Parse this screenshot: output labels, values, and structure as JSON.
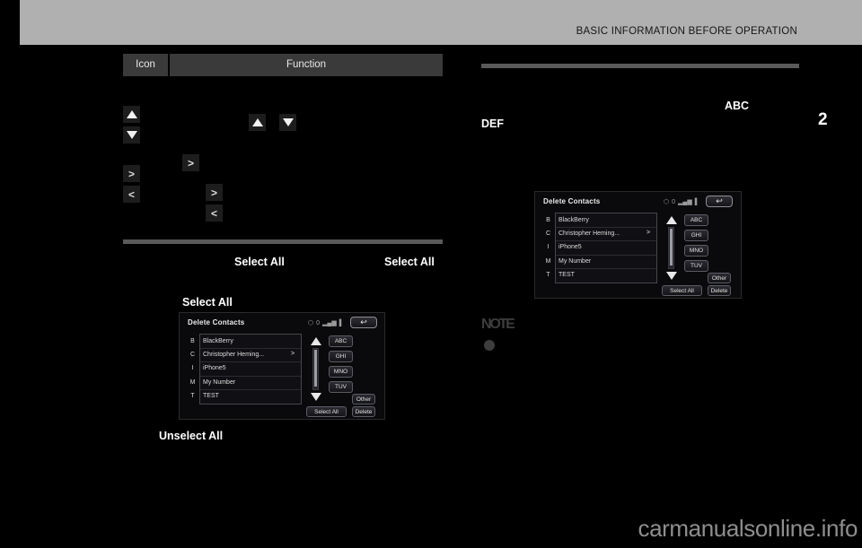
{
  "header": {
    "title": "BASIC INFORMATION BEFORE OPERATION",
    "page_number": "2",
    "band_color": "#b0b0b0"
  },
  "watermark": "carmanualsonline.info",
  "left_column": {
    "table": {
      "columns": [
        "Icon",
        "Function"
      ],
      "icons": [
        {
          "name": "triangle-up-icon",
          "glyph": "▲"
        },
        {
          "name": "triangle-down-icon",
          "glyph": "▼"
        },
        {
          "name": "chevron-right-icon",
          "glyph": ">"
        },
        {
          "name": "chevron-left-icon",
          "glyph": "<"
        }
      ],
      "inline_icons": [
        {
          "name": "triangle-up-icon",
          "glyph": "▲"
        },
        {
          "name": "triangle-down-icon",
          "glyph": "▼"
        },
        {
          "name": "chevron-right-icon",
          "glyph": ">"
        },
        {
          "name": "chevron-right-icon",
          "glyph": ">"
        },
        {
          "name": "chevron-left-icon",
          "glyph": "<"
        }
      ]
    },
    "labels": {
      "select_all_1": "Select All",
      "select_all_2": "Select All",
      "select_all_3": "Select All",
      "unselect_all": "Unselect All"
    }
  },
  "right_column": {
    "labels": {
      "abc": "ABC",
      "def": "DEF"
    },
    "note": {
      "word": "NOTE",
      "bullet": "●"
    }
  },
  "device_screen": {
    "title": "Delete Contacts",
    "status_icons": [
      {
        "name": "bluetooth-icon",
        "glyph": "⬡"
      },
      {
        "name": "roaming-icon",
        "glyph": "0"
      },
      {
        "name": "signal-bars-icon",
        "glyph": "▂▄▆"
      },
      {
        "name": "battery-icon",
        "glyph": "▌"
      }
    ],
    "back_button": {
      "name": "back-icon",
      "glyph": "↩"
    },
    "contacts": [
      {
        "letter": "B",
        "name": "BlackBerry"
      },
      {
        "letter": "C",
        "name": "Christopher Heming...",
        "arrow": ">"
      },
      {
        "letter": "I",
        "name": "iPhone5"
      },
      {
        "letter": "M",
        "name": "My Number"
      },
      {
        "letter": "T",
        "name": "TEST"
      }
    ],
    "scroll": {
      "up": "▲",
      "down": "▼"
    },
    "alpha_keys": [
      "ABC",
      "GHI",
      "MNO",
      "TUV"
    ],
    "other_key": "Other",
    "buttons": {
      "select_all": "Select All",
      "delete": "Delete"
    }
  }
}
